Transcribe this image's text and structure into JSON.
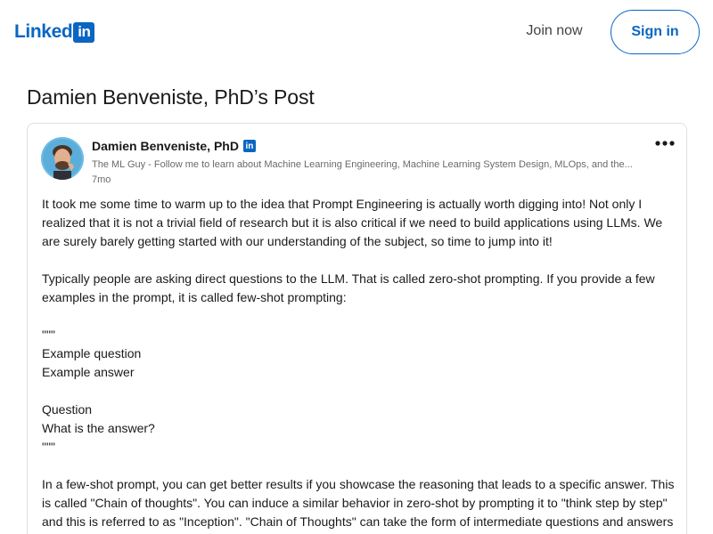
{
  "header": {
    "logo_text": "Linked",
    "logo_box": "in",
    "join_now_label": "Join now",
    "sign_in_label": "Sign in"
  },
  "page": {
    "title": "Damien Benveniste, PhD’s Post"
  },
  "post": {
    "author_name": "Damien Benveniste, PhD",
    "author_badge": "in",
    "author_headline": "The ML Guy - Follow me to learn about Machine Learning Engineering, Machine Learning System Design, MLOps, and the...",
    "time": "7mo",
    "body_lines": [
      "It took me some time to warm up to the idea that Prompt Engineering is actually worth digging into! Not only I",
      "realized that it is not a trivial field of research but it is also critical if we need to build applications using LLMs. We",
      "are surely barely getting started with our understanding of the subject, so time to jump into it!",
      "",
      "Typically people are asking direct questions to the LLM. That is called zero-shot prompting. If you provide a few",
      "examples in the prompt, it is called few-shot prompting:",
      "",
      "\"\"\"",
      "Example question",
      "Example answer",
      "",
      "Question",
      "What is the answer?",
      "\"\"\"",
      "",
      "In a few-shot prompt, you can get better results if you showcase the reasoning that leads to a specific answer. This",
      "is called \"Chain of thoughts\". You can induce a similar behavior in zero-shot by prompting it to \"think step by step\"",
      "and this is referred to as \"Inception\". \"Chain of Thoughts\" can take the form of intermediate questions and answers"
    ]
  },
  "colors": {
    "brand": "#0a66c2",
    "text_primary": "rgba(0,0,0,0.9)",
    "text_secondary": "rgba(0,0,0,0.6)",
    "border": "#e0dfdc"
  },
  "icons": {
    "more": "more-horizontal-icon",
    "badge": "linkedin-badge-icon"
  }
}
